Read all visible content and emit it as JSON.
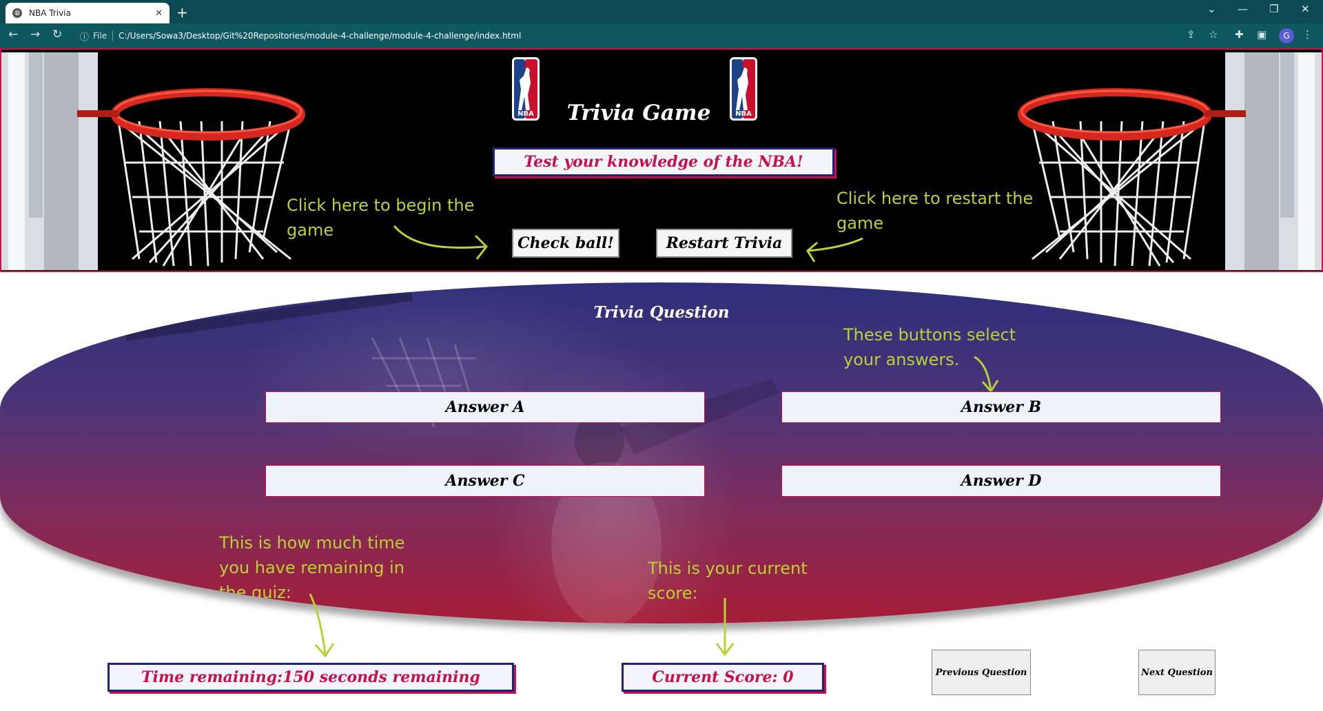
{
  "browser": {
    "tab_title": "NBA Trivia",
    "protocol_label": "File",
    "url": "C:/Users/Sowa3/Desktop/Git%20Repositories/module-4-challenge/module-4-challenge/index.html"
  },
  "header": {
    "title": "Trivia Game",
    "tagline": "Test your knowledge of the NBA!",
    "start_button": "Check ball!",
    "restart_button": "Restart Trivia",
    "start_note": "Click here to begin the game",
    "restart_note": "Click here to restart the game",
    "logo_text": "NBA"
  },
  "question": {
    "title": "Trivia Question",
    "answers_note": "These buttons select your answers.",
    "answers": [
      "Answer A",
      "Answer B",
      "Answer C",
      "Answer D"
    ]
  },
  "footer": {
    "time_note": "This is how much time you have remaining in the quiz:",
    "score_note": "This is your current score:",
    "time_remaining": "Time remaining:150 seconds remaining",
    "current_score": "Current Score: 0",
    "prev_button": "Previous Question",
    "next_button": "Next Question"
  },
  "colors": {
    "accent_red": "#c8104a",
    "navy": "#20207a",
    "note_green": "#b8d234",
    "chrome_teal": "#0b4a52"
  },
  "icons": [
    "globe-icon",
    "close-icon",
    "plus-icon",
    "back-icon",
    "forward-icon",
    "reload-icon",
    "info-icon",
    "share-icon",
    "star-icon",
    "extensions-icon",
    "sidepanel-icon",
    "menu-icon",
    "minimize-icon",
    "restore-icon",
    "window-close-icon"
  ]
}
